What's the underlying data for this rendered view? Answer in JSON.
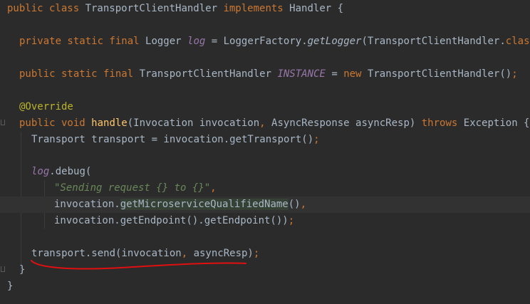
{
  "editor": {
    "lines": [
      {
        "tokens": [
          {
            "t": "public class ",
            "c": "kw"
          },
          {
            "t": "TransportClientHandler ",
            "c": ""
          },
          {
            "t": "implements ",
            "c": "kw"
          },
          {
            "t": "Handler {",
            "c": ""
          }
        ]
      },
      {
        "tokens": []
      },
      {
        "tokens": [
          {
            "t": "private static final ",
            "c": "kw"
          },
          {
            "t": "Logger ",
            "c": ""
          },
          {
            "t": "log",
            "c": "static-field"
          },
          {
            "t": " = LoggerFactory.",
            "c": ""
          },
          {
            "t": "getLogger",
            "c": "static-call"
          },
          {
            "t": "(TransportClientHandler.",
            "c": ""
          },
          {
            "t": "class",
            "c": "kw"
          },
          {
            "t": ");",
            "c": "pn"
          }
        ]
      },
      {
        "tokens": []
      },
      {
        "tokens": [
          {
            "t": "public static final ",
            "c": "kw"
          },
          {
            "t": "TransportClientHandler ",
            "c": ""
          },
          {
            "t": "INSTANCE",
            "c": "static-field"
          },
          {
            "t": " = ",
            "c": ""
          },
          {
            "t": "new ",
            "c": "kw"
          },
          {
            "t": "TransportClientHandler()",
            "c": ""
          },
          {
            "t": ";",
            "c": "pn"
          }
        ]
      },
      {
        "tokens": []
      },
      {
        "tokens": [
          {
            "t": "@Override",
            "c": "ann"
          }
        ]
      },
      {
        "tokens": [
          {
            "t": "public void ",
            "c": "kw"
          },
          {
            "t": "handle",
            "c": "fn"
          },
          {
            "t": "(Invocation invocation",
            "c": ""
          },
          {
            "t": ", ",
            "c": "pn"
          },
          {
            "t": "AsyncResponse asyncResp) ",
            "c": ""
          },
          {
            "t": "throws ",
            "c": "kw"
          },
          {
            "t": "Exception {",
            "c": ""
          }
        ]
      },
      {
        "tokens": [
          {
            "t": "Transport transport = invocation.getTransport()",
            "c": ""
          },
          {
            "t": ";",
            "c": "pn"
          }
        ]
      },
      {
        "tokens": []
      },
      {
        "tokens": [
          {
            "t": "log",
            "c": "static-field"
          },
          {
            "t": ".debug(",
            "c": ""
          }
        ]
      },
      {
        "tokens": [
          {
            "t": "\"Sending request {} to {}\"",
            "c": "str"
          },
          {
            "t": ",",
            "c": "pn"
          }
        ]
      },
      {
        "tokens": [
          {
            "t": "invocation.",
            "c": ""
          },
          {
            "t": "getMi",
            "c": "hl"
          },
          {
            "t": "|",
            "c": "caret"
          },
          {
            "t": "croserviceQualifiedName",
            "c": "hl"
          },
          {
            "t": "()",
            "c": ""
          },
          {
            "t": ",",
            "c": "pn"
          }
        ]
      },
      {
        "tokens": [
          {
            "t": "invocation.getEndpoint().getEndpoint())",
            "c": ""
          },
          {
            "t": ";",
            "c": "pn"
          }
        ]
      },
      {
        "tokens": []
      },
      {
        "tokens": [
          {
            "t": "transport.send(invocation",
            "c": ""
          },
          {
            "t": ", ",
            "c": "pn"
          },
          {
            "t": "asyncResp)",
            "c": ""
          },
          {
            "t": ";",
            "c": "pn"
          }
        ]
      },
      {
        "tokens": [
          {
            "t": "}",
            "c": ""
          }
        ]
      },
      {
        "tokens": [
          {
            "t": "}",
            "c": ""
          }
        ]
      }
    ]
  }
}
